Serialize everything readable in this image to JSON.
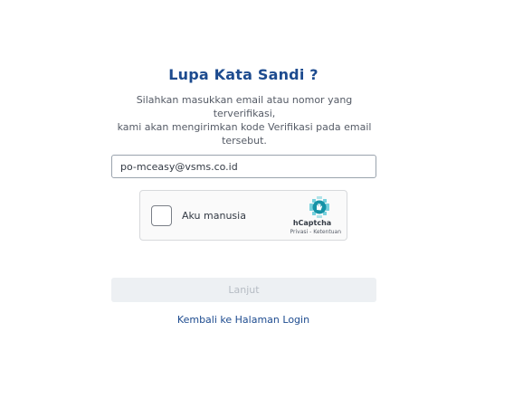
{
  "title": "Lupa Kata Sandi ?",
  "description": [
    "Silahkan masukkan email atau nomor yang terverifikasi,",
    "kami akan mengirimkan kode Verifikasi pada email",
    "tersebut."
  ],
  "email": {
    "value": "po-mceasy@vsms.co.id"
  },
  "captcha": {
    "label": "Aku manusia",
    "brand": "hCaptcha",
    "privacy": "Privasi",
    "separator": " - ",
    "terms": "Ketentuan",
    "logo_icon": "hcaptcha-logo-icon",
    "logo_color": "#1fb6c9"
  },
  "submit_label": "Lanjut",
  "back_link": "Kembali ke Halaman Login",
  "colors": {
    "title": "#1d4b8f",
    "button_disabled_bg": "#edf0f3",
    "button_disabled_text": "#b6bcc4"
  }
}
